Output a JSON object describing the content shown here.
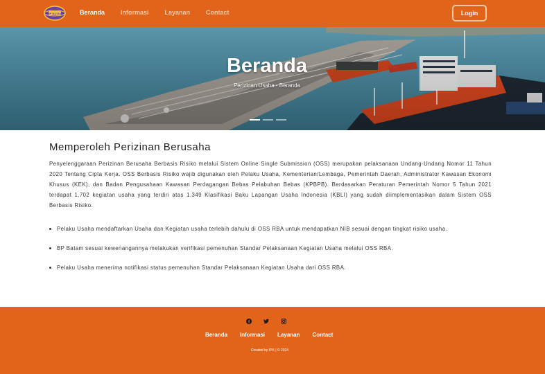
{
  "brand": {
    "logo_text": "BP BATAM",
    "accent_color": "#e2641b"
  },
  "nav": {
    "items": [
      {
        "label": "Beranda",
        "active": true
      },
      {
        "label": "Informasi",
        "active": false
      },
      {
        "label": "Layanan",
        "active": false
      },
      {
        "label": "Contact",
        "active": false
      }
    ],
    "login_label": "Login"
  },
  "hero": {
    "title": "Beranda",
    "breadcrumb": "Perizinan Usaha - Beranda",
    "slides": 3,
    "active_slide": 0
  },
  "main": {
    "heading": "Memperoleh Perizinan Berusaha",
    "intro": "Penyelenggaraan Perizinan Berusaha Berbasis Risiko melalui Sistem Online Single Submission (OSS) merupakan pelaksanaan Undang-Undang Nomor 11 Tahun 2020 Tentang Cipta Kerja. OSS Berbasis Risiko wajib digunakan oleh Pelaku Usaha, Kementerian/Lembaga, Pemerintah Daerah, Administrator Kawasan Ekonomi Khusus (KEK), dan Badan Pengusahaan Kawasan Perdagangan Bebas Pelabuhan Bebas (KPBPB). Berdasarkan Peraturan Pemerintah Nomor 5 Tahun 2021 terdapat 1.702 kegiatan usaha yang terdiri atas 1.349 Klasifikasi Baku Lapangan Usaha Indonesia (KBLI) yang sudah diimplementasikan dalam Sistem OSS Berbasis Risiko.",
    "bullets": [
      "Pelaku Usaha mendaftarkan Usaha dan Kegiatan usaha terlebih dahulu di OSS RBA untuk mendapatkan NIB sesuai dengan tingkat risiko usaha.",
      "BP Batam sesuai kewenangannya melakukan verifikasi pemenuhan Standar Pelaksanaan Kegiatan Usaha melalui OSS RBA.",
      "Pelaku Usaha menerima notifikasi status pemenuhan Standar Pelaksanaan Kegiatan Usaha dari OSS RBA."
    ]
  },
  "footer": {
    "social": [
      {
        "icon": "facebook-icon"
      },
      {
        "icon": "twitter-icon"
      },
      {
        "icon": "instagram-icon"
      }
    ],
    "links": [
      "Beranda",
      "Informasi",
      "Layanan",
      "Contact"
    ],
    "copyright": "Created by IPK | © 2024"
  }
}
